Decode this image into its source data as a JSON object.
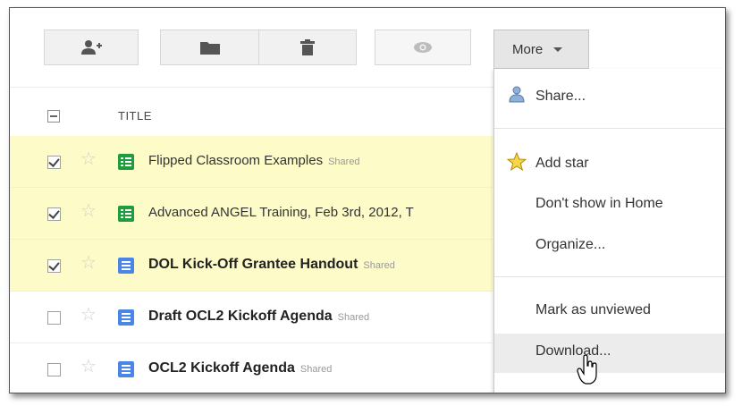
{
  "toolbar": {
    "buttons": [
      "add-people-icon",
      "folder-icon",
      "trash-icon",
      "eye-icon"
    ],
    "more_label": "More"
  },
  "list": {
    "header_title": "TITLE",
    "rows": [
      {
        "name": "Flipped Classroom Examples",
        "badge": "Shared",
        "type": "spreadsheet",
        "checked": true,
        "bold": false
      },
      {
        "name": "Advanced ANGEL Training, Feb 3rd, 2012, T",
        "badge": "",
        "type": "spreadsheet",
        "checked": true,
        "bold": false
      },
      {
        "name": "DOL Kick-Off Grantee Handout",
        "badge": "Shared",
        "type": "document",
        "checked": true,
        "bold": true
      },
      {
        "name": "Draft OCL2 Kickoff Agenda",
        "badge": "Shared",
        "type": "document",
        "checked": false,
        "bold": true
      },
      {
        "name": "OCL2 Kickoff Agenda",
        "badge": "Shared",
        "type": "document",
        "checked": false,
        "bold": true
      }
    ]
  },
  "menu": {
    "share": "Share...",
    "add_star": "Add star",
    "dont_show_home": "Don't show in Home",
    "organize": "Organize...",
    "mark_unviewed": "Mark as unviewed",
    "download": "Download..."
  },
  "colors": {
    "selected_row": "#fdfbc8",
    "spreadsheet_icon": "#1f9d3d",
    "document_icon": "#4a86e8"
  }
}
